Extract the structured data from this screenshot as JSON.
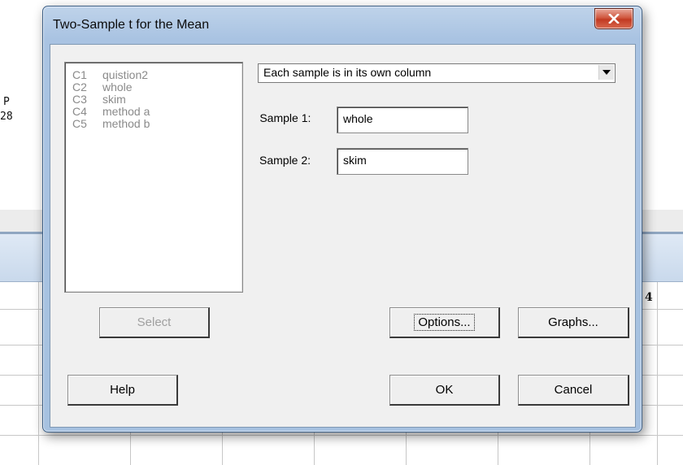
{
  "background": {
    "session_lines": [
      "P",
      "28"
    ],
    "column_header_label": "4"
  },
  "dialog": {
    "title": "Two-Sample t for the Mean",
    "variables": [
      {
        "col": "C1",
        "name": "quistion2"
      },
      {
        "col": "C2",
        "name": "whole"
      },
      {
        "col": "C3",
        "name": "skim"
      },
      {
        "col": "C4",
        "name": "method a"
      },
      {
        "col": "C5",
        "name": "method b"
      }
    ],
    "data_arrangement": "Each sample is in its own column",
    "sample1": {
      "label": "Sample 1:",
      "value": "whole"
    },
    "sample2": {
      "label": "Sample 2:",
      "value": "skim"
    },
    "buttons": {
      "select": "Select",
      "options": "Options...",
      "graphs": "Graphs...",
      "help": "Help",
      "ok": "OK",
      "cancel": "Cancel"
    }
  },
  "colors": {
    "title_bar": "#a9c3e2",
    "close_button": "#c23a22",
    "client": "#f0f0f0",
    "disabled_text": "#8a8a8a"
  }
}
